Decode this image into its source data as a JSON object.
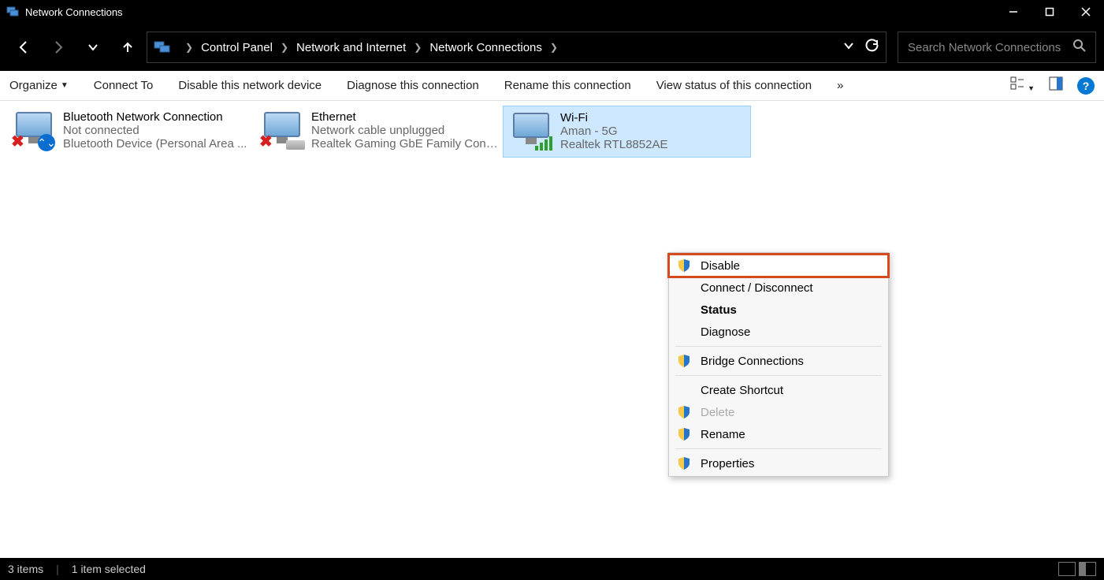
{
  "window": {
    "title": "Network Connections"
  },
  "breadcrumb": {
    "items": [
      "Control Panel",
      "Network and Internet",
      "Network Connections"
    ]
  },
  "search": {
    "placeholder": "Search Network Connections"
  },
  "toolbar": {
    "organize": "Organize",
    "connect_to": "Connect To",
    "disable": "Disable this network device",
    "diagnose": "Diagnose this connection",
    "rename": "Rename this connection",
    "view_status": "View status of this connection",
    "overflow": "»"
  },
  "connections": [
    {
      "name": "Bluetooth Network Connection",
      "status": "Not connected",
      "device": "Bluetooth Device (Personal Area ..."
    },
    {
      "name": "Ethernet",
      "status": "Network cable unplugged",
      "device": "Realtek Gaming GbE Family Contr..."
    },
    {
      "name": "Wi-Fi",
      "status": "Aman - 5G",
      "device": "Realtek RTL8852AE"
    }
  ],
  "context_menu": {
    "disable": "Disable",
    "connect": "Connect / Disconnect",
    "status": "Status",
    "diagnose": "Diagnose",
    "bridge": "Bridge Connections",
    "shortcut": "Create Shortcut",
    "delete": "Delete",
    "rename": "Rename",
    "properties": "Properties"
  },
  "statusbar": {
    "items": "3 items",
    "selected": "1 item selected"
  }
}
